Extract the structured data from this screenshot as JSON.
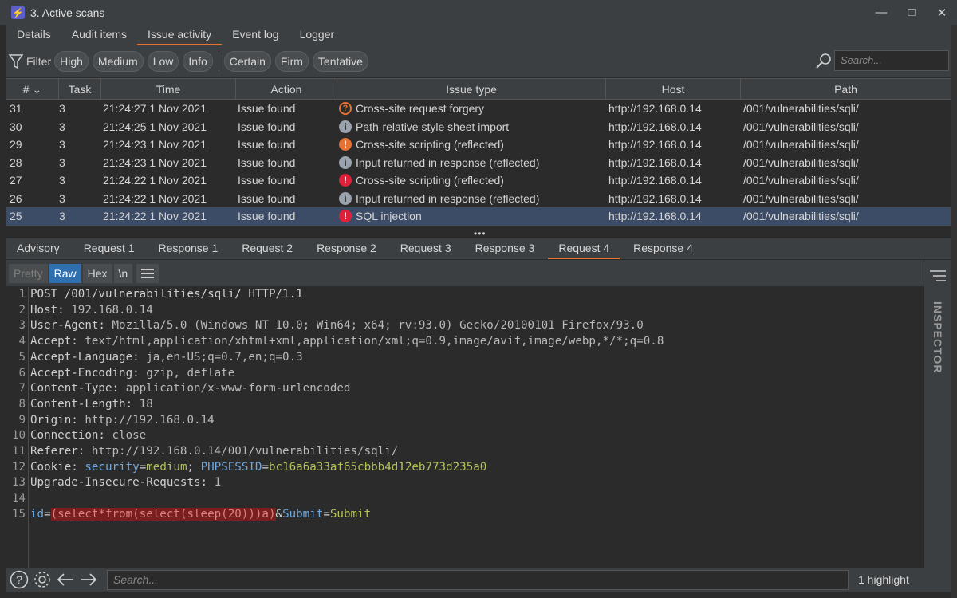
{
  "window": {
    "title": "3. Active scans"
  },
  "top_tabs": [
    {
      "label": "Details",
      "active": false
    },
    {
      "label": "Audit items",
      "active": false
    },
    {
      "label": "Issue activity",
      "active": true
    },
    {
      "label": "Event log",
      "active": false
    },
    {
      "label": "Logger",
      "active": false
    }
  ],
  "filter": {
    "label": "Filter",
    "severity_chips": [
      "High",
      "Medium",
      "Low",
      "Info"
    ],
    "confidence_chips": [
      "Certain",
      "Firm",
      "Tentative"
    ],
    "search_placeholder": "Search..."
  },
  "table": {
    "columns": [
      "#",
      "Task",
      "Time",
      "Action",
      "Issue type",
      "Host",
      "Path"
    ],
    "rows": [
      {
        "num": "31",
        "task": "3",
        "time": "21:24:27 1 Nov 2021",
        "action": "Issue found",
        "severity": "tentative-medium",
        "issue": "Cross-site request forgery",
        "host": "http://192.168.0.14",
        "path": "/001/vulnerabilities/sqli/",
        "selected": false
      },
      {
        "num": "30",
        "task": "3",
        "time": "21:24:25 1 Nov 2021",
        "action": "Issue found",
        "severity": "info",
        "issue": "Path-relative style sheet import",
        "host": "http://192.168.0.14",
        "path": "/001/vulnerabilities/sqli/",
        "selected": false
      },
      {
        "num": "29",
        "task": "3",
        "time": "21:24:23 1 Nov 2021",
        "action": "Issue found",
        "severity": "medium",
        "issue": "Cross-site scripting (reflected)",
        "host": "http://192.168.0.14",
        "path": "/001/vulnerabilities/sqli/",
        "selected": false
      },
      {
        "num": "28",
        "task": "3",
        "time": "21:24:23 1 Nov 2021",
        "action": "Issue found",
        "severity": "info",
        "issue": "Input returned in response (reflected)",
        "host": "http://192.168.0.14",
        "path": "/001/vulnerabilities/sqli/",
        "selected": false
      },
      {
        "num": "27",
        "task": "3",
        "time": "21:24:22 1 Nov 2021",
        "action": "Issue found",
        "severity": "high",
        "issue": "Cross-site scripting (reflected)",
        "host": "http://192.168.0.14",
        "path": "/001/vulnerabilities/sqli/",
        "selected": false
      },
      {
        "num": "26",
        "task": "3",
        "time": "21:24:22 1 Nov 2021",
        "action": "Issue found",
        "severity": "info",
        "issue": "Input returned in response (reflected)",
        "host": "http://192.168.0.14",
        "path": "/001/vulnerabilities/sqli/",
        "selected": false
      },
      {
        "num": "25",
        "task": "3",
        "time": "21:24:22 1 Nov 2021",
        "action": "Issue found",
        "severity": "high",
        "issue": "SQL injection",
        "host": "http://192.168.0.14",
        "path": "/001/vulnerabilities/sqli/",
        "selected": true
      }
    ]
  },
  "sub_tabs": [
    {
      "label": "Advisory",
      "active": false
    },
    {
      "label": "Request 1",
      "active": false
    },
    {
      "label": "Response 1",
      "active": false
    },
    {
      "label": "Request 2",
      "active": false
    },
    {
      "label": "Response 2",
      "active": false
    },
    {
      "label": "Request 3",
      "active": false
    },
    {
      "label": "Response 3",
      "active": false
    },
    {
      "label": "Request 4",
      "active": true
    },
    {
      "label": "Response 4",
      "active": false
    }
  ],
  "editor_toolbar": {
    "pretty": "Pretty",
    "raw": "Raw",
    "hex": "Hex",
    "newline": "\\n"
  },
  "inspector_label": "INSPECTOR",
  "request_lines": [
    {
      "n": "1",
      "parts": [
        {
          "t": "POST /001/vulnerabilities/sqli/ HTTP/1.1",
          "c": "hk"
        }
      ]
    },
    {
      "n": "2",
      "parts": [
        {
          "t": "Host: ",
          "c": "hk"
        },
        {
          "t": "192.168.0.14",
          "c": "hv"
        }
      ]
    },
    {
      "n": "3",
      "parts": [
        {
          "t": "User-Agent: ",
          "c": "hk"
        },
        {
          "t": "Mozilla/5.0 (Windows NT 10.0; Win64; x64; rv:93.0) Gecko/20100101 Firefox/93.0",
          "c": "hv"
        }
      ]
    },
    {
      "n": "4",
      "parts": [
        {
          "t": "Accept: ",
          "c": "hk"
        },
        {
          "t": "text/html,application/xhtml+xml,application/xml;q=0.9,image/avif,image/webp,*/*;q=0.8",
          "c": "hv"
        }
      ]
    },
    {
      "n": "5",
      "parts": [
        {
          "t": "Accept-Language: ",
          "c": "hk"
        },
        {
          "t": "ja,en-US;q=0.7,en;q=0.3",
          "c": "hv"
        }
      ]
    },
    {
      "n": "6",
      "parts": [
        {
          "t": "Accept-Encoding: ",
          "c": "hk"
        },
        {
          "t": "gzip, deflate",
          "c": "hv"
        }
      ]
    },
    {
      "n": "7",
      "parts": [
        {
          "t": "Content-Type: ",
          "c": "hk"
        },
        {
          "t": "application/x-www-form-urlencoded",
          "c": "hv"
        }
      ]
    },
    {
      "n": "8",
      "parts": [
        {
          "t": "Content-Length: ",
          "c": "hk"
        },
        {
          "t": "18",
          "c": "hv"
        }
      ]
    },
    {
      "n": "9",
      "parts": [
        {
          "t": "Origin: ",
          "c": "hk"
        },
        {
          "t": "http://192.168.0.14",
          "c": "hv"
        }
      ]
    },
    {
      "n": "10",
      "parts": [
        {
          "t": "Connection: ",
          "c": "hk"
        },
        {
          "t": "close",
          "c": "hv"
        }
      ]
    },
    {
      "n": "11",
      "parts": [
        {
          "t": "Referer: ",
          "c": "hk"
        },
        {
          "t": "http://192.168.0.14/001/vulnerabilities/sqli/",
          "c": "hv"
        }
      ]
    },
    {
      "n": "12",
      "parts": [
        {
          "t": "Cookie: ",
          "c": "hk"
        },
        {
          "t": "security",
          "c": "ck"
        },
        {
          "t": "=",
          "c": "hk"
        },
        {
          "t": "medium",
          "c": "cv"
        },
        {
          "t": "; ",
          "c": "hk"
        },
        {
          "t": "PHPSESSID",
          "c": "ck"
        },
        {
          "t": "=",
          "c": "hk"
        },
        {
          "t": "bc16a6a33af65cbbb4d12eb773d235a0",
          "c": "cv"
        }
      ]
    },
    {
      "n": "13",
      "parts": [
        {
          "t": "Upgrade-Insecure-Requests: ",
          "c": "hk"
        },
        {
          "t": "1",
          "c": "hv"
        }
      ]
    },
    {
      "n": "14",
      "parts": []
    },
    {
      "n": "15",
      "parts": [
        {
          "t": "id",
          "c": "ck"
        },
        {
          "t": "=",
          "c": "hk"
        },
        {
          "t": "(select*from(select(sleep(20)))a)",
          "c": "hl"
        },
        {
          "t": "&",
          "c": "hk"
        },
        {
          "t": "Submit",
          "c": "ck"
        },
        {
          "t": "=",
          "c": "hk"
        },
        {
          "t": "Submit",
          "c": "cv"
        }
      ]
    }
  ],
  "bottom": {
    "search_placeholder": "Search...",
    "highlight_count": "1 highlight"
  }
}
